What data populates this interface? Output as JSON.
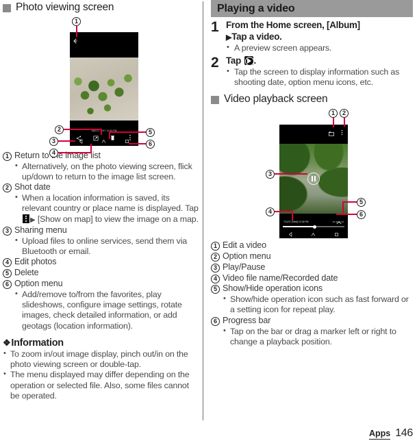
{
  "left": {
    "section_title": "Photo viewing screen",
    "figure": {
      "shot_date": "July 12, 2017 12:34 PM",
      "callouts": [
        "1",
        "2",
        "3",
        "4",
        "5",
        "6"
      ],
      "icons": {
        "back": "back-arrow-icon",
        "share": "share-icon",
        "edit": "edit-photo-icon",
        "delete": "trash-icon",
        "overflow": "overflow-menu-icon",
        "nav_back": "nav-back-icon",
        "nav_home": "nav-home-icon",
        "nav_recents": "nav-recents-icon"
      }
    },
    "legend": [
      {
        "num": "1",
        "label": "Return to the image list",
        "sub": [
          "Alternatively, on the photo viewing screen, flick up/down to return to the image list screen."
        ]
      },
      {
        "num": "2",
        "label": "Shot date",
        "sub_pre": "When a location information is saved, its relevant country or place name is displayed. Tap ",
        "sub_post": " [Show on map] to view the image on a map."
      },
      {
        "num": "3",
        "label": "Sharing menu",
        "sub": [
          "Upload files to online services, send them via Bluetooth or email."
        ]
      },
      {
        "num": "4",
        "label": "Edit photos",
        "sub": []
      },
      {
        "num": "5",
        "label": "Delete",
        "sub": []
      },
      {
        "num": "6",
        "label": "Option menu",
        "sub": [
          "Add/remove to/from the favorites, play slideshows, configure image settings, rotate images, check detailed information, or add geotags (location information)."
        ]
      }
    ],
    "information": {
      "heading": "Information",
      "items": [
        "To zoom in/out image display, pinch out/in on the photo viewing screen or double-tap.",
        "The menu displayed may differ depending on the operation or selected file. Also, some files cannot be operated."
      ]
    }
  },
  "right": {
    "bar_title": "Playing a video",
    "steps": [
      {
        "num": "1",
        "title_pre": "From the Home screen, [Album]",
        "title_post": "Tap a video.",
        "bullets": [
          "A preview screen appears."
        ]
      },
      {
        "num": "2",
        "title_pre": "Tap ",
        "title_post": ".",
        "bullets": [
          "Tap the screen to display information such as shooting date, option menu icons, etc."
        ]
      }
    ],
    "section_title": "Video playback screen",
    "figure": {
      "file_date": "7/12/17 [Wed] 12:34 PM",
      "time_code": "00:44/01:28",
      "callouts": [
        "1",
        "2",
        "3",
        "4",
        "5",
        "6"
      ],
      "icons": {
        "edit_video": "edit-video-icon",
        "overflow": "overflow-menu-icon",
        "pause": "pause-icon",
        "chevron_up": "chevron-up-icon",
        "nav_back": "nav-back-icon",
        "nav_home": "nav-home-icon",
        "nav_recents": "nav-recents-icon"
      }
    },
    "legend": [
      {
        "num": "1",
        "label": "Edit a video",
        "sub": []
      },
      {
        "num": "2",
        "label": "Option menu",
        "sub": []
      },
      {
        "num": "3",
        "label": "Play/Pause",
        "sub": []
      },
      {
        "num": "4",
        "label": "Video file name/Recorded date",
        "sub": []
      },
      {
        "num": "5",
        "label": "Show/Hide operation icons",
        "sub": [
          "Show/hide operation icon such as fast forward or a setting icon for repeat play."
        ]
      },
      {
        "num": "6",
        "label": "Progress bar",
        "sub": [
          "Tap on the bar or drag a marker left or right to change a playback position."
        ]
      }
    ]
  },
  "footer": {
    "tab": "Apps",
    "page": "146"
  },
  "colors": {
    "leader": "#d4003c",
    "bar": "#9a9a9a",
    "square": "#8b8b8b"
  }
}
